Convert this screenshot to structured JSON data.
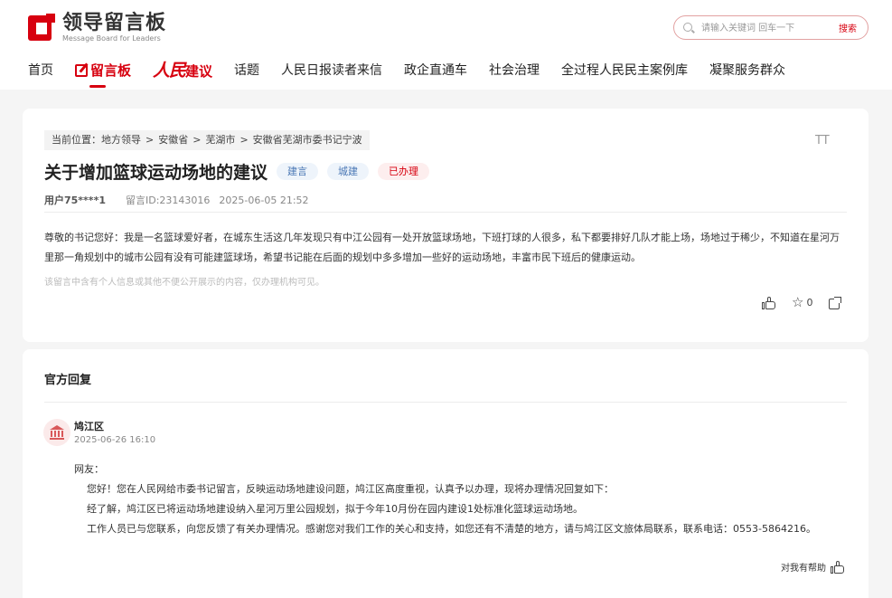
{
  "header": {
    "logo_cn": "领导留言板",
    "logo_en": "Message Board for Leaders",
    "search_placeholder": "请输入关键词 回车一下",
    "search_button": "搜索"
  },
  "nav": {
    "home": "首页",
    "board": "留言板",
    "rmjy_script": "人民",
    "rmjy_text": "建议",
    "topics": "话题",
    "readers": "人民日报读者来信",
    "business": "政企直通车",
    "governance": "社会治理",
    "democracy": "全过程人民民主案例库",
    "service": "凝聚服务群众"
  },
  "message": {
    "breadcrumb": {
      "label": "当前位置：",
      "items": [
        "地方领导",
        "安徽省",
        "芜湖市",
        "安徽省芜湖市委书记宁波"
      ],
      "sep": ">"
    },
    "font_toggle": "TT",
    "title": "关于增加篮球运动场地的建议",
    "tags": [
      "建言",
      "城建",
      "已办理"
    ],
    "user": "用户75****1",
    "message_id": "留言ID:23143016",
    "time": "2025-06-05 21:52",
    "body": "尊敬的书记您好：我是一名篮球爱好者，在城东生活这几年发现只有中江公园有一处开放篮球场地，下班打球的人很多，私下都要排好几队才能上场，场地过于稀少，不知道在星河万里那一角规划中的城市公园有没有可能建篮球场，希望书记能在后面的规划中多多增加一些好的运动场地，丰富市民下班后的健康运动。",
    "note": "该留言中含有个人信息或其他不便公开展示的内容，仅办理机构可见。",
    "star_count": "0"
  },
  "reply": {
    "heading": "官方回复",
    "org_name": "鸠江区",
    "org_time": "2025-06-26 16:10",
    "greeting": "网友：",
    "paragraphs": [
      "您好！您在人民网给市委书记留言，反映运动场地建设问题，鸠江区高度重视，认真予以办理，现将办理情况回复如下：",
      "经了解，鸠江区已将运动场地建设纳入星河万里公园规划，拟于今年10月份在园内建设1处标准化篮球运动场地。",
      "工作人员已与您联系，向您反馈了有关办理情况。感谢您对我们工作的关心和支持，如您还有不清楚的地方，请与鸠江区文旅体局联系，联系电话：0553-5864216。"
    ],
    "helpful_label": "对我有帮助"
  }
}
